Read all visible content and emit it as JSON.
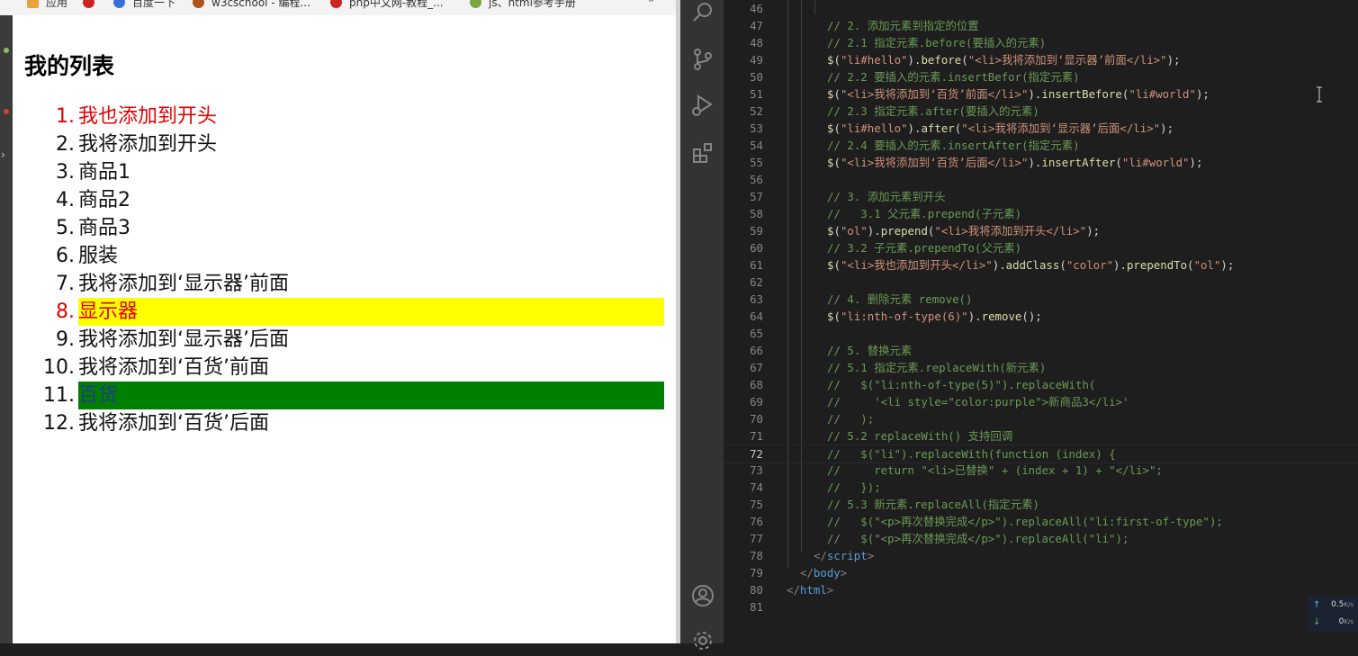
{
  "browser": {
    "bookmarks": [
      {
        "label": "应用",
        "color": "#e8a33a"
      },
      {
        "label": "",
        "color": "#cc2222"
      },
      {
        "label": "百度一下",
        "color": "#3a6fd8"
      },
      {
        "label": "w3cschool - 编程...",
        "color": "#b0521e"
      },
      {
        "label": "php中文网-教程_...",
        "color": "#cc2222"
      },
      {
        "label": "js、html参考手册",
        "color": "#7aa640"
      }
    ],
    "more": "»",
    "heading": "我的列表",
    "items": [
      {
        "num": "1.",
        "text": "我也添加到开头"
      },
      {
        "num": "2.",
        "text": "我将添加到开头"
      },
      {
        "num": "3.",
        "text": "商品1"
      },
      {
        "num": "4.",
        "text": "商品2"
      },
      {
        "num": "5.",
        "text": "商品3"
      },
      {
        "num": "6.",
        "text": "服装"
      },
      {
        "num": "7.",
        "text": "我将添加到‘显示器’前面"
      },
      {
        "num": "8.",
        "text": "显示器"
      },
      {
        "num": "9.",
        "text": "我将添加到‘显示器’后面"
      },
      {
        "num": "10.",
        "text": "我将添加到‘百货’前面"
      },
      {
        "num": "11.",
        "text": "百货"
      },
      {
        "num": "12.",
        "text": "我将添加到‘百货’后面"
      }
    ]
  },
  "editor": {
    "lines": [
      {
        "n": "46",
        "parts": []
      },
      {
        "n": "47",
        "parts": [
          {
            "k": "c",
            "t": "// 2. 添加元素到指定的位置"
          }
        ]
      },
      {
        "n": "48",
        "parts": [
          {
            "k": "c",
            "t": "// 2.1 指定元素.before(要插入的元素)"
          }
        ]
      },
      {
        "n": "49",
        "parts": [
          {
            "k": "f",
            "t": "$"
          },
          {
            "k": "p",
            "t": "("
          },
          {
            "k": "s",
            "t": "\"li#hello\""
          },
          {
            "k": "p",
            "t": ")."
          },
          {
            "k": "f",
            "t": "before"
          },
          {
            "k": "p",
            "t": "("
          },
          {
            "k": "s",
            "t": "\"<li>我将添加到‘显示器’前面</li>\""
          },
          {
            "k": "p",
            "t": ");"
          }
        ]
      },
      {
        "n": "50",
        "parts": [
          {
            "k": "c",
            "t": "// 2.2 要插入的元素.insertBefor(指定元素)"
          }
        ]
      },
      {
        "n": "51",
        "parts": [
          {
            "k": "f",
            "t": "$"
          },
          {
            "k": "p",
            "t": "("
          },
          {
            "k": "s",
            "t": "\"<li>我将添加到‘百货’前面</li>\""
          },
          {
            "k": "p",
            "t": ")."
          },
          {
            "k": "f",
            "t": "insertBefore"
          },
          {
            "k": "p",
            "t": "("
          },
          {
            "k": "s",
            "t": "\"li#world\""
          },
          {
            "k": "p",
            "t": ");"
          }
        ]
      },
      {
        "n": "52",
        "parts": [
          {
            "k": "c",
            "t": "// 2.3 指定元素.after(要插入的元素)"
          }
        ]
      },
      {
        "n": "53",
        "parts": [
          {
            "k": "f",
            "t": "$"
          },
          {
            "k": "p",
            "t": "("
          },
          {
            "k": "s",
            "t": "\"li#hello\""
          },
          {
            "k": "p",
            "t": ")."
          },
          {
            "k": "f",
            "t": "after"
          },
          {
            "k": "p",
            "t": "("
          },
          {
            "k": "s",
            "t": "\"<li>我将添加到‘显示器’后面</li>\""
          },
          {
            "k": "p",
            "t": ");"
          }
        ]
      },
      {
        "n": "54",
        "parts": [
          {
            "k": "c",
            "t": "// 2.4 要插入的元素.insertAfter(指定元素)"
          }
        ]
      },
      {
        "n": "55",
        "parts": [
          {
            "k": "f",
            "t": "$"
          },
          {
            "k": "p",
            "t": "("
          },
          {
            "k": "s",
            "t": "\"<li>我将添加到‘百货’后面</li>\""
          },
          {
            "k": "p",
            "t": ")."
          },
          {
            "k": "f",
            "t": "insertAfter"
          },
          {
            "k": "p",
            "t": "("
          },
          {
            "k": "s",
            "t": "\"li#world\""
          },
          {
            "k": "p",
            "t": ");"
          }
        ]
      },
      {
        "n": "56",
        "parts": []
      },
      {
        "n": "57",
        "parts": [
          {
            "k": "c",
            "t": "// 3. 添加元素到开头"
          }
        ]
      },
      {
        "n": "58",
        "parts": [
          {
            "k": "c",
            "t": "//   3.1 父元素.prepend(子元素)"
          }
        ]
      },
      {
        "n": "59",
        "parts": [
          {
            "k": "f",
            "t": "$"
          },
          {
            "k": "p",
            "t": "("
          },
          {
            "k": "s",
            "t": "\"ol\""
          },
          {
            "k": "p",
            "t": ")."
          },
          {
            "k": "f",
            "t": "prepend"
          },
          {
            "k": "p",
            "t": "("
          },
          {
            "k": "s",
            "t": "\"<li>我将添加到开头</li>\""
          },
          {
            "k": "p",
            "t": ");"
          }
        ]
      },
      {
        "n": "60",
        "parts": [
          {
            "k": "c",
            "t": "// 3.2 子元素.prependTo(父元素)"
          }
        ]
      },
      {
        "n": "61",
        "parts": [
          {
            "k": "f",
            "t": "$"
          },
          {
            "k": "p",
            "t": "("
          },
          {
            "k": "s",
            "t": "\"<li>我也添加到开头</li>\""
          },
          {
            "k": "p",
            "t": ")."
          },
          {
            "k": "f",
            "t": "addClass"
          },
          {
            "k": "p",
            "t": "("
          },
          {
            "k": "s",
            "t": "\"color\""
          },
          {
            "k": "p",
            "t": ")."
          },
          {
            "k": "f",
            "t": "prependTo"
          },
          {
            "k": "p",
            "t": "("
          },
          {
            "k": "s",
            "t": "\"ol\""
          },
          {
            "k": "p",
            "t": ");"
          }
        ]
      },
      {
        "n": "62",
        "parts": []
      },
      {
        "n": "63",
        "parts": [
          {
            "k": "c",
            "t": "// 4. 删除元素 remove()"
          }
        ]
      },
      {
        "n": "64",
        "parts": [
          {
            "k": "f",
            "t": "$"
          },
          {
            "k": "p",
            "t": "("
          },
          {
            "k": "s",
            "t": "\"li:nth-of-type(6)\""
          },
          {
            "k": "p",
            "t": ")."
          },
          {
            "k": "f",
            "t": "remove"
          },
          {
            "k": "p",
            "t": "();"
          }
        ]
      },
      {
        "n": "65",
        "parts": []
      },
      {
        "n": "66",
        "parts": [
          {
            "k": "c",
            "t": "// 5. 替换元素"
          }
        ]
      },
      {
        "n": "67",
        "parts": [
          {
            "k": "c",
            "t": "// 5.1 指定元素.replaceWith(新元素)"
          }
        ]
      },
      {
        "n": "68",
        "parts": [
          {
            "k": "c",
            "t": "//   $(\"li:nth-of-type(5)\").replaceWith("
          }
        ]
      },
      {
        "n": "69",
        "parts": [
          {
            "k": "c",
            "t": "//     '<li style=\"color:purple\">新商品3</li>'"
          }
        ]
      },
      {
        "n": "70",
        "parts": [
          {
            "k": "c",
            "t": "//   );"
          }
        ]
      },
      {
        "n": "71",
        "parts": [
          {
            "k": "c",
            "t": "// 5.2 replaceWith() 支持回调"
          }
        ]
      },
      {
        "n": "72",
        "parts": [
          {
            "k": "c",
            "t": "//   $(\"li\").replaceWith(function (index) {"
          }
        ]
      },
      {
        "n": "73",
        "parts": [
          {
            "k": "c",
            "t": "//     return \"<li>已替换\" + (index + 1) + \"</li>\";"
          }
        ]
      },
      {
        "n": "74",
        "parts": [
          {
            "k": "c",
            "t": "//   });"
          }
        ]
      },
      {
        "n": "75",
        "parts": [
          {
            "k": "c",
            "t": "// 5.3 新元素.replaceAll(指定元素)"
          }
        ]
      },
      {
        "n": "76",
        "parts": [
          {
            "k": "c",
            "t": "//   $(\"<p>再次替换完成</p>\").replaceAll(\"li:first-of-type\");"
          }
        ]
      },
      {
        "n": "77",
        "parts": [
          {
            "k": "c",
            "t": "//   $(\"<p>再次替换完成</p>\").replaceAll(\"li\");"
          }
        ]
      },
      {
        "n": "78",
        "parts": [
          {
            "k": "tb",
            "t": "</"
          },
          {
            "k": "t",
            "t": "script"
          },
          {
            "k": "tb",
            "t": ">"
          }
        ]
      },
      {
        "n": "79",
        "parts": [
          {
            "k": "tb",
            "t": "</"
          },
          {
            "k": "t",
            "t": "body"
          },
          {
            "k": "tb",
            "t": ">"
          }
        ]
      },
      {
        "n": "80",
        "parts": [
          {
            "k": "tb",
            "t": "</"
          },
          {
            "k": "t",
            "t": "html"
          },
          {
            "k": "tb",
            "t": ">"
          }
        ]
      },
      {
        "n": "81",
        "parts": []
      }
    ],
    "active_line": "72"
  },
  "activity_bar": {
    "icons": [
      "search-icon",
      "source-control-icon",
      "run-debug-icon",
      "extensions-icon",
      "account-icon",
      "settings-gear-icon"
    ]
  },
  "net_monitor": {
    "upload": "0.5",
    "upload_unit": "K/s",
    "download": "0",
    "download_unit": "K/s",
    "up_color": "#4fc3f7",
    "down_color": "#66bb6a"
  }
}
